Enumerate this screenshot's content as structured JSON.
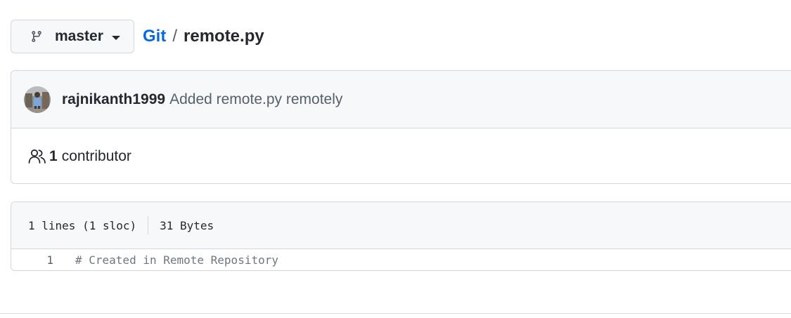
{
  "branch": {
    "name": "master",
    "icon": "git-branch-icon"
  },
  "breadcrumb": {
    "repo": "Git",
    "separator": "/",
    "file": "remote.py"
  },
  "commit": {
    "author": "rajnikanth1999",
    "message": "Added remote.py remotely",
    "avatar_icon": "user-avatar"
  },
  "contributors": {
    "icon": "people-icon",
    "count": "1",
    "label": "contributor"
  },
  "file": {
    "lines_info": "1 lines (1 sloc)",
    "size": "31 Bytes",
    "code": [
      {
        "line": "1",
        "text": "# Created in Remote Repository"
      }
    ]
  },
  "colors": {
    "link": "#0969da",
    "border": "#d0d7de",
    "header_bg": "#f6f8fa",
    "text": "#24292f",
    "muted": "#57606a"
  }
}
